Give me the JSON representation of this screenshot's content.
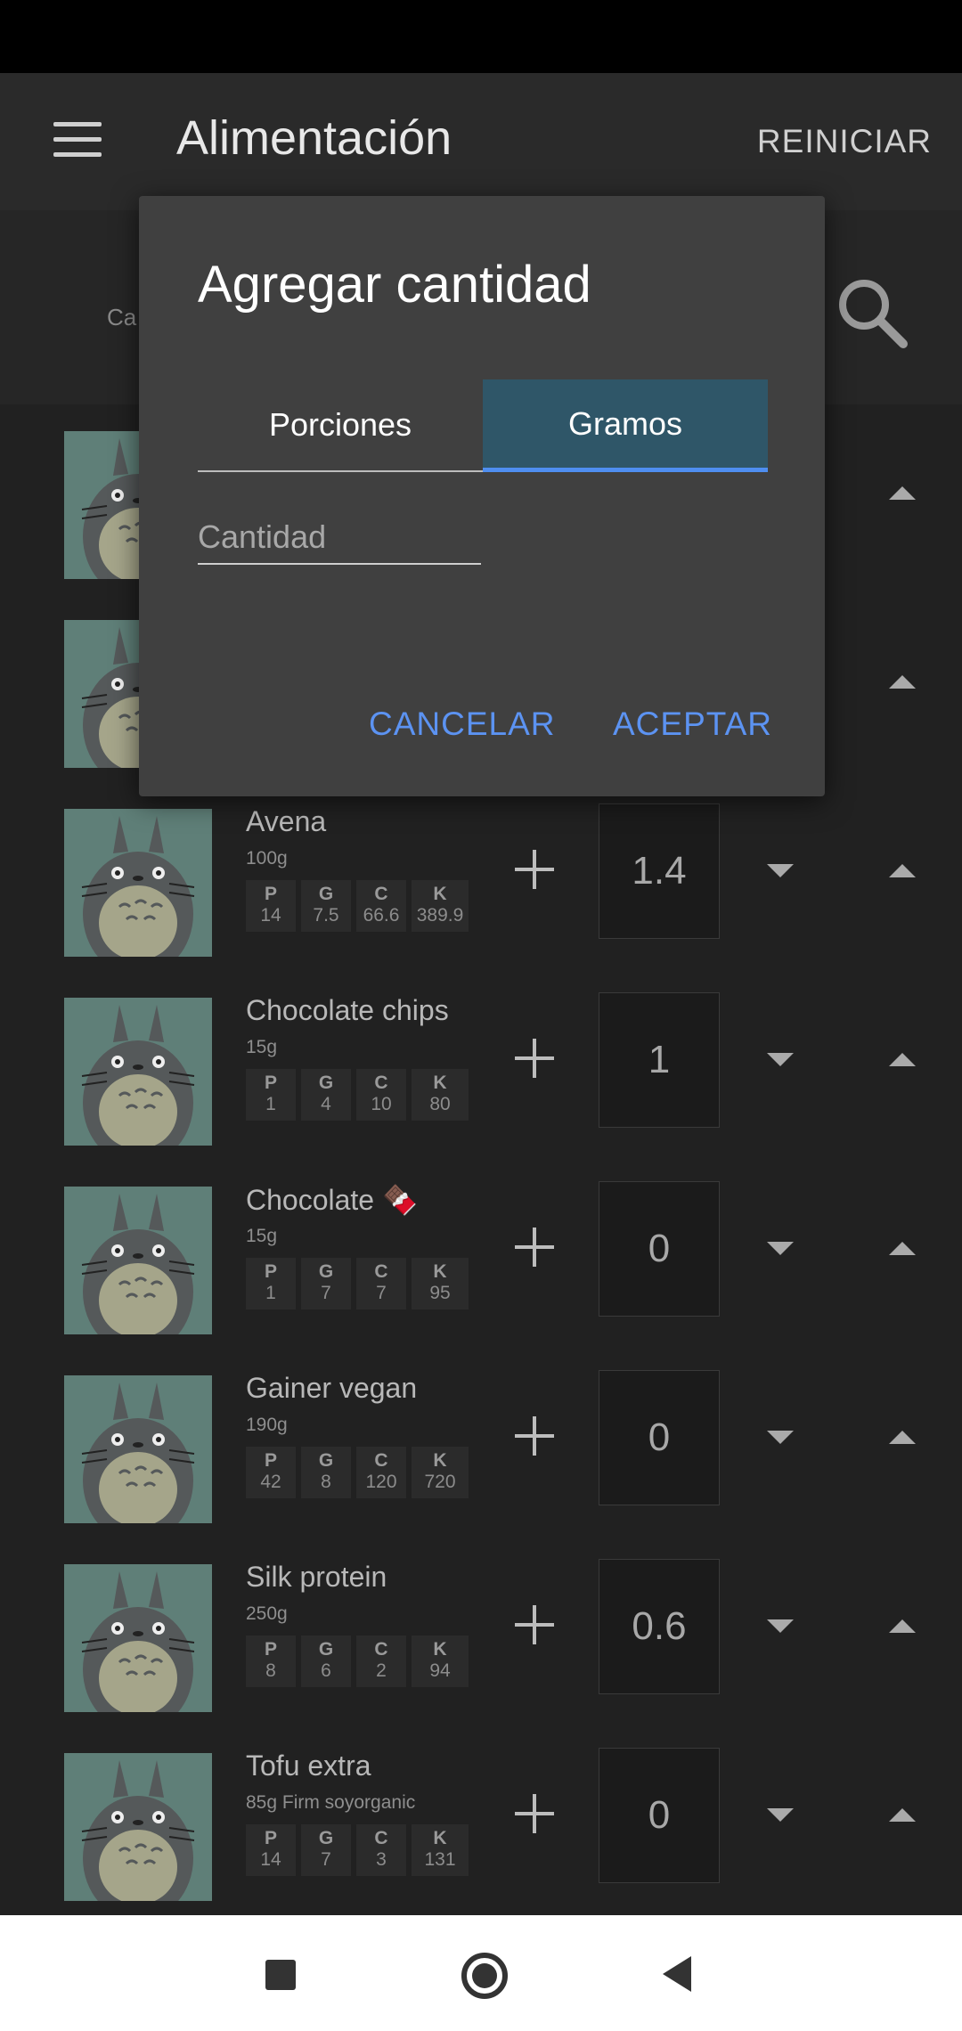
{
  "app": {
    "title": "Alimentación",
    "reset_label": "REINICIAR",
    "menu_icon": "menu-icon",
    "search_hint": "Ca",
    "search_icon": "search-icon"
  },
  "dialog": {
    "title": "Agregar cantidad",
    "tabs": [
      {
        "label": "Porciones",
        "selected": false
      },
      {
        "label": "Gramos",
        "selected": true
      }
    ],
    "quantity_placeholder": "Cantidad",
    "quantity_value": "",
    "cancel_label": "CANCELAR",
    "accept_label": "ACEPTAR",
    "accent_color": "#5c93f2"
  },
  "macro_labels": {
    "p": "P",
    "g": "G",
    "c": "C",
    "k": "K"
  },
  "foods": [
    {
      "name": "",
      "sub": "",
      "p": "",
      "g": "",
      "c": "",
      "k": "",
      "qty": ""
    },
    {
      "name": "",
      "sub": "",
      "p": "",
      "g": "",
      "c": "",
      "k": "",
      "qty": ""
    },
    {
      "name": "Avena",
      "sub": "100g",
      "p": "14",
      "g": "7.5",
      "c": "66.6",
      "k": "389.9",
      "qty": "1.4"
    },
    {
      "name": "Chocolate chips",
      "sub": "15g",
      "p": "1",
      "g": "4",
      "c": "10",
      "k": "80",
      "qty": "1"
    },
    {
      "name": "Chocolate 🍫",
      "sub": "15g",
      "p": "1",
      "g": "7",
      "c": "7",
      "k": "95",
      "qty": "0"
    },
    {
      "name": "Gainer vegan",
      "sub": "190g",
      "p": "42",
      "g": "8",
      "c": "120",
      "k": "720",
      "qty": "0"
    },
    {
      "name": "Silk protein",
      "sub": "250g",
      "p": "8",
      "g": "6",
      "c": "2",
      "k": "94",
      "qty": "0.6"
    },
    {
      "name": "Tofu extra",
      "sub": "85g Firm soyorganic",
      "p": "14",
      "g": "7",
      "c": "3",
      "k": "131",
      "qty": "0"
    }
  ]
}
